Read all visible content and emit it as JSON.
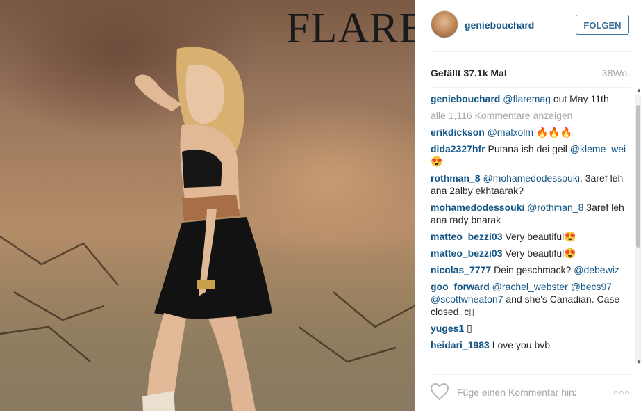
{
  "photo": {
    "brand": "FLARE"
  },
  "header": {
    "username": "geniebouchard",
    "follow_label": "FOLGEN"
  },
  "stats": {
    "likes": "Gefällt 37.1k Mal",
    "age": "38Wo."
  },
  "caption": {
    "user": "geniebouchard",
    "mention": "@flaremag",
    "text": " out May 11th"
  },
  "view_all": "alle 1,116 Kommentare anzeigen",
  "comments": [
    {
      "user": "erikdickson",
      "parts": [
        {
          "t": "m",
          "v": "@malxolm"
        },
        {
          "t": "x",
          "v": " 🔥🔥🔥"
        }
      ]
    },
    {
      "user": "dida2327hfr",
      "parts": [
        {
          "t": "x",
          "v": "Putana ish dei geil "
        },
        {
          "t": "m",
          "v": "@kleme_wei"
        },
        {
          "t": "x",
          "v": " 😍"
        }
      ]
    },
    {
      "user": "rothman_8",
      "parts": [
        {
          "t": "m",
          "v": "@mohamedodessouki"
        },
        {
          "t": "x",
          "v": ". 3aref leh ana 2alby ekhtaarak?"
        }
      ]
    },
    {
      "user": "mohamedodessouki",
      "parts": [
        {
          "t": "m",
          "v": "@rothman_8"
        },
        {
          "t": "x",
          "v": " 3aref leh ana rady bnarak"
        }
      ]
    },
    {
      "user": "matteo_bezzi03",
      "parts": [
        {
          "t": "x",
          "v": "Very beautiful😍"
        }
      ]
    },
    {
      "user": "matteo_bezzi03",
      "parts": [
        {
          "t": "x",
          "v": "Very beautiful😍"
        }
      ]
    },
    {
      "user": "nicolas_7777",
      "parts": [
        {
          "t": "x",
          "v": "Dein geschmack? "
        },
        {
          "t": "m",
          "v": "@debewiz"
        }
      ]
    },
    {
      "user": "goo_forward",
      "parts": [
        {
          "t": "m",
          "v": "@rachel_webster"
        },
        {
          "t": "x",
          "v": " "
        },
        {
          "t": "m",
          "v": "@becs97"
        },
        {
          "t": "x",
          "v": " "
        },
        {
          "t": "m",
          "v": "@scottwheaton7"
        },
        {
          "t": "x",
          "v": " and she's Canadian. Case closed. c▯"
        }
      ]
    },
    {
      "user": "yuges1",
      "parts": [
        {
          "t": "x",
          "v": "▯"
        }
      ]
    },
    {
      "user": "heidari_1983",
      "parts": [
        {
          "t": "x",
          "v": "Love you bvb"
        }
      ]
    }
  ],
  "footer": {
    "placeholder": "Füge einen Kommentar hinzu ...",
    "more": "○○○"
  }
}
